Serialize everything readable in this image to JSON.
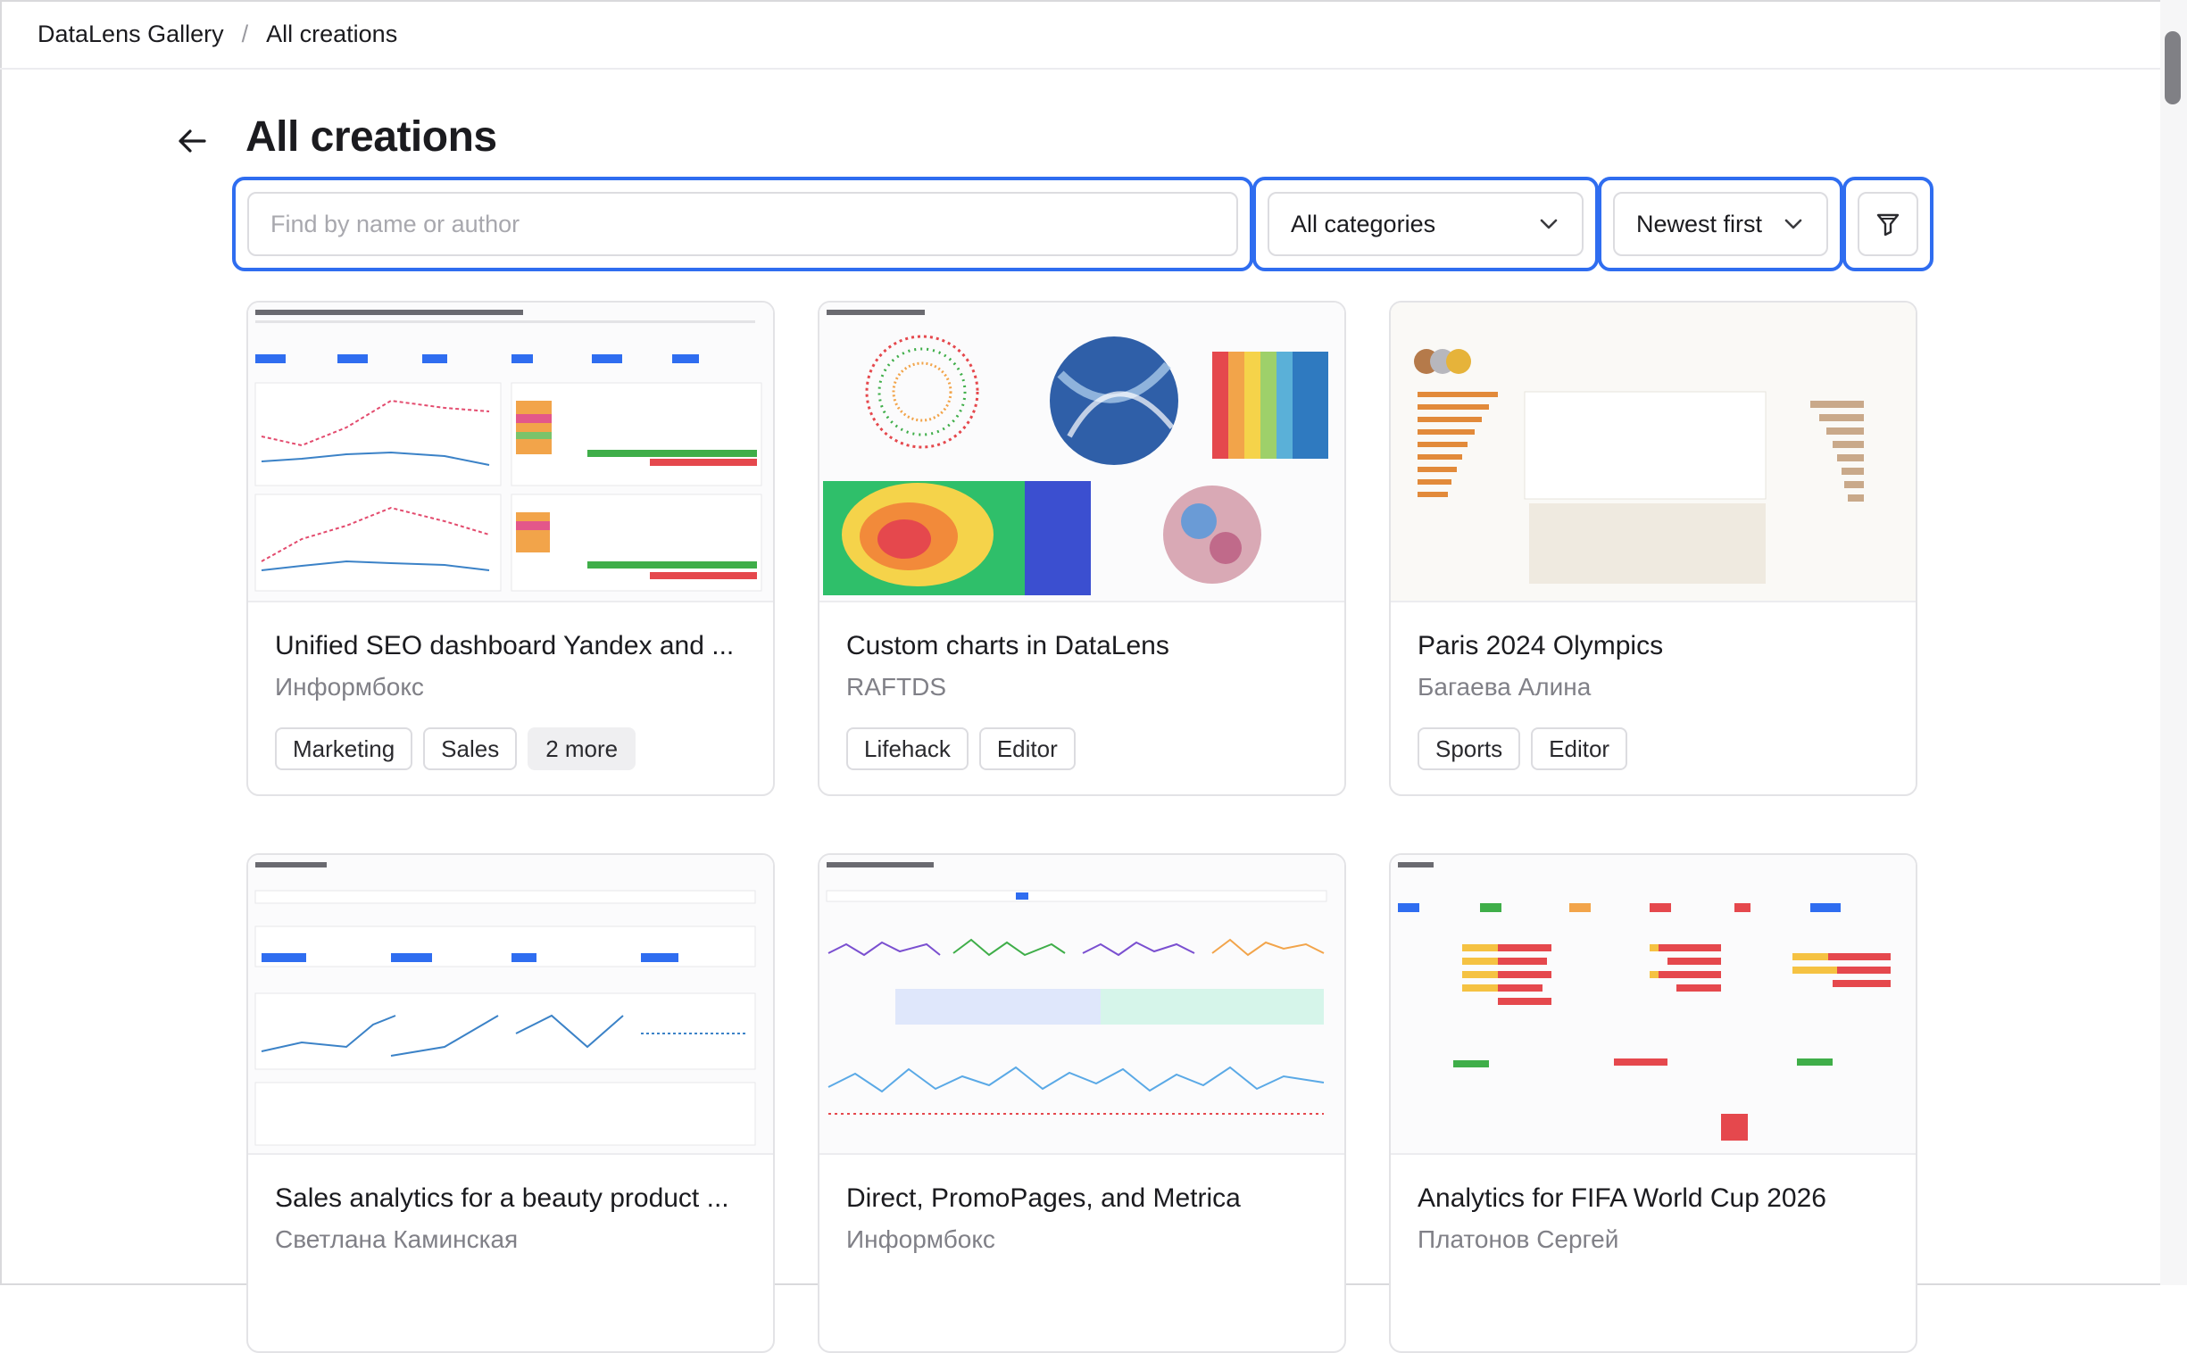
{
  "breadcrumb": {
    "root": "DataLens Gallery",
    "separator": "/",
    "current": "All creations"
  },
  "page": {
    "title": "All creations"
  },
  "filters": {
    "search_placeholder": "Find by name or author",
    "category": "All categories",
    "sort": "Newest first"
  },
  "icons": {
    "back": "arrow-left-icon",
    "chevron": "chevron-down-icon",
    "filter": "filter-funnel-icon"
  },
  "colors": {
    "accent_focus": "#2f6df0"
  },
  "cards": [
    {
      "title": "Unified SEO dashboard Yandex and ...",
      "author": "Информбокс",
      "tags": [
        "Marketing",
        "Sales",
        "2 more"
      ]
    },
    {
      "title": "Custom charts in DataLens",
      "author": "RAFTDS",
      "tags": [
        "Lifehack",
        "Editor"
      ]
    },
    {
      "title": "Paris 2024 Olympics",
      "author": "Багаева Алина",
      "tags": [
        "Sports",
        "Editor"
      ]
    },
    {
      "title": "Sales analytics for a beauty product ...",
      "author": "Светлана Каминская",
      "tags": []
    },
    {
      "title": "Direct, PromoPages, and Metrica",
      "author": "Информбокс",
      "tags": []
    },
    {
      "title": "Analytics for FIFA World Cup 2026",
      "author": "Платонов Сергей",
      "tags": []
    }
  ]
}
